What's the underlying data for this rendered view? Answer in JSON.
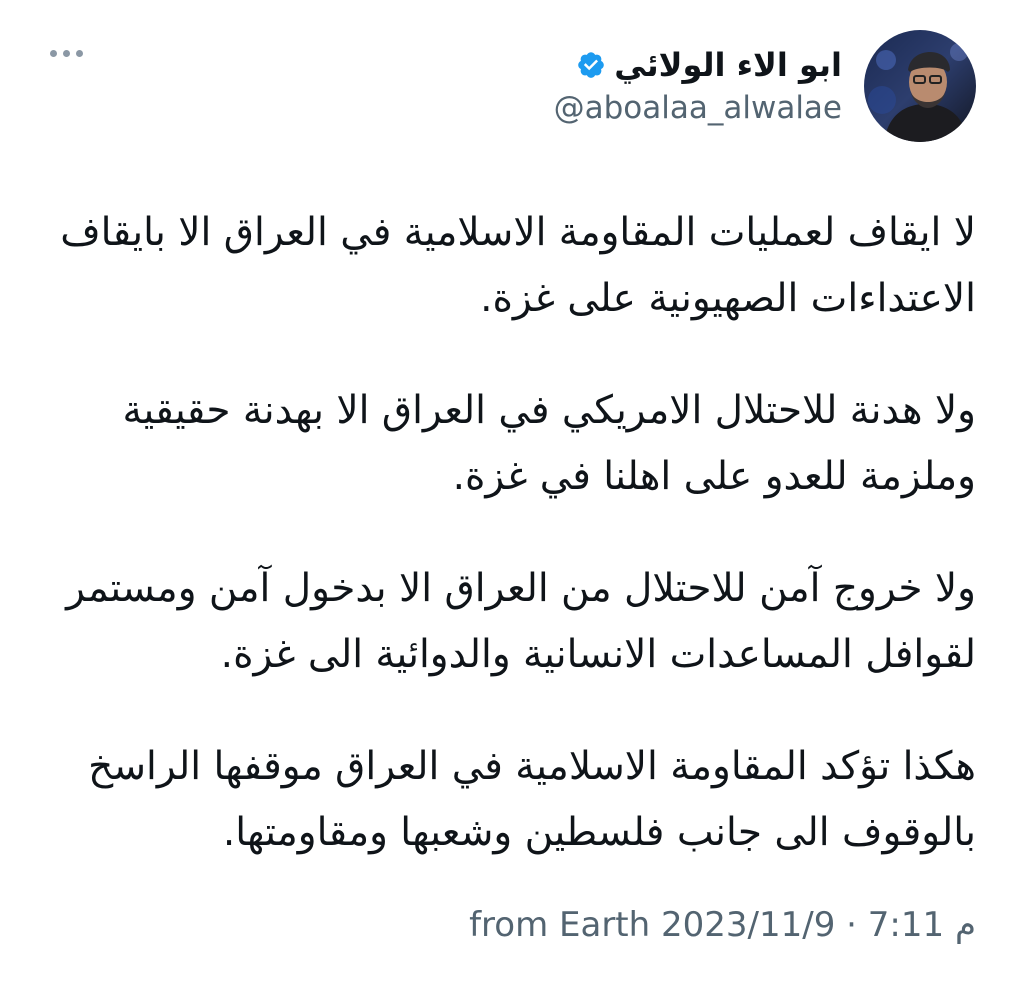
{
  "tweet": {
    "author": {
      "display_name": "ابو الاء الولائي",
      "handle": "@aboalaa_alwalae",
      "verified": true
    },
    "paragraphs": [
      {
        "lines": [
          "لا ايقاف لعمليات المقاومة الاسلامية في العراق الا بايقاف",
          "الاعتداءات الصهيونية على غزة."
        ]
      },
      {
        "lines": [
          "ولا هدنة للاحتلال الامريكي في العراق الا بهدنة حقيقية",
          "وملزمة للعدو على اهلنا في غزة."
        ]
      },
      {
        "lines": [
          "ولا خروج آمن للاحتلال من العراق الا بدخول آمن ومستمر",
          "لقوافل المساعدات الانسانية والدوائية الى غزة."
        ]
      },
      {
        "lines": [
          "هكذا تؤكد المقاومة الاسلامية في العراق موقفها الراسخ",
          "بالوقوف الى جانب فلسطين وشعبها ومقاومتها."
        ]
      }
    ],
    "meta": "from Earth م 7:11 · 2023/11/9"
  },
  "colors": {
    "text": "#0f1419",
    "secondary": "#536471",
    "verified": "#1d9bf0",
    "background": "#ffffff"
  },
  "icons": {
    "verified": "verified-badge-icon",
    "more": "more-dots-icon"
  }
}
